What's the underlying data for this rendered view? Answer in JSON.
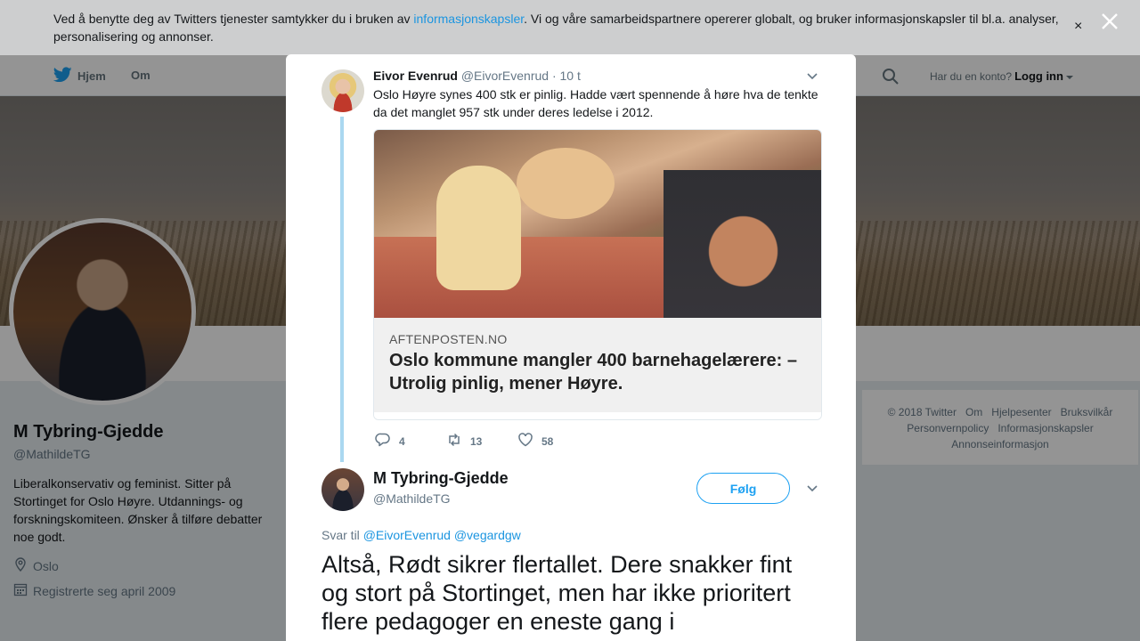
{
  "cookie": {
    "text_before": "Ved å benytte deg av Twitters tjenester samtykker du i bruken av ",
    "link": "informasjonskapsler",
    "text_after": ". Vi og våre samarbeidspartnere opererer globalt, og bruker informasjonskapsler til bl.a. analyser, personalisering og annonser.",
    "close": "×"
  },
  "nav": {
    "home": "Hjem",
    "about": "Om",
    "account_prompt": "Har du en konto?",
    "login": "Logg inn"
  },
  "profile": {
    "name": "M Tybring-Gjedde",
    "handle": "@MathildeTG",
    "bio": "Liberalkonservativ og feminist. Sitter på Stortinget for Oslo Høyre. Utdannings- og forskningskomiteen. Ønsker å tilføre debatter noe godt.",
    "location": "Oslo",
    "joined": "Registrerte seg april 2009"
  },
  "footer": {
    "links": [
      "© 2018 Twitter",
      "Om",
      "Hjelpesenter",
      "Bruksvilkår",
      "Personvernpolicy",
      "Informasjonskapsler",
      "Annonseinformasjon"
    ]
  },
  "parent_tweet": {
    "name": "Eivor Evenrud",
    "handle": "@EivorEvenrud",
    "time": "· 10 t",
    "text": "Oslo Høyre synes 400 stk er pinlig. Hadde vært spennende å høre hva de tenkte da det manglet 957 stk under deres ledelse i 2012.",
    "card": {
      "domain": "AFTENPOSTEN.NO",
      "title": "Oslo kommune mangler 400 barnehagelærere: – Utrolig pinlig, mener Høyre."
    },
    "replies": "4",
    "retweets": "13",
    "likes": "58"
  },
  "main_tweet": {
    "name": "M Tybring-Gjedde",
    "handle": "@MathildeTG",
    "follow": "Følg",
    "reply_prefix": "Svar til",
    "reply_users": "@EivorEvenrud @vegardgw",
    "text": "Altså, Rødt sikrer flertallet. Dere snakker fint og stort på Stortinget, men har ikke prioritert flere pedagoger en eneste gang i"
  },
  "colors": {
    "accent": "#1da1f2",
    "link": "#1b95e0",
    "thread_line": "#aad8f0"
  }
}
